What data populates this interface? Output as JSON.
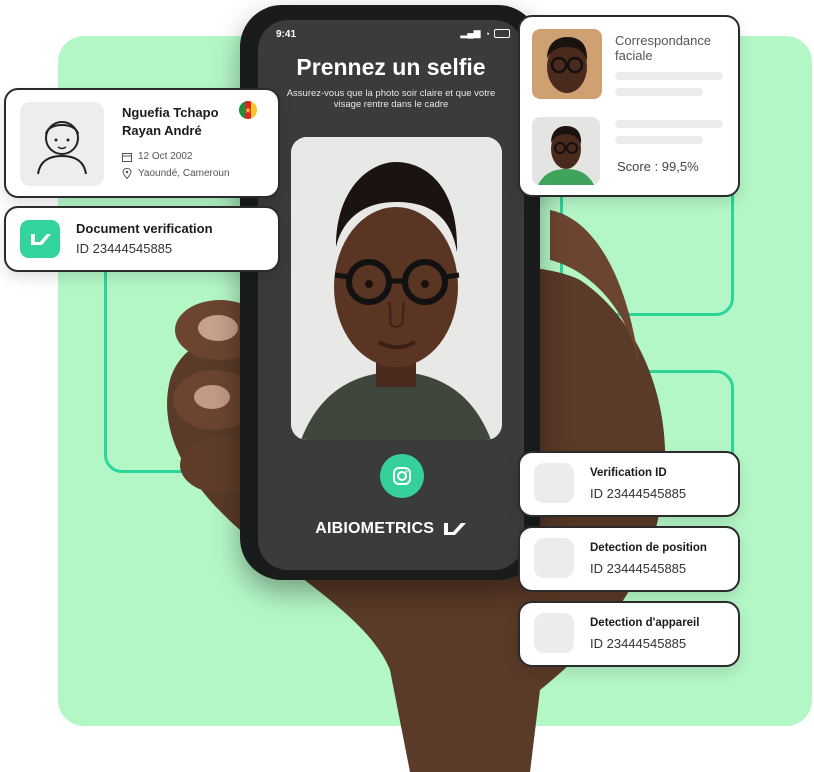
{
  "phone": {
    "status_time": "9:41",
    "title": "Prennez un selfie",
    "subtitle": "Assurez-vous que la photo soir claire et que votre visage rentre dans le cadre",
    "brand": "AIBIOMETRICS"
  },
  "profile_card": {
    "name_line1": "Nguefia Tchapo",
    "name_line2": "Rayan André",
    "date": "12 Oct 2002",
    "location": "Yaoundé, Cameroun"
  },
  "document_card": {
    "title": "Document verification",
    "id": "ID 23444545885"
  },
  "match_card": {
    "title": "Correspondance faciale",
    "score": "Score : 99,5%"
  },
  "checks": [
    {
      "title": "Verification ID",
      "id": "ID 23444545885"
    },
    {
      "title": "Detection de position",
      "id": "ID 23444545885"
    },
    {
      "title": "Detection d'appareil",
      "id": "ID 23444545885"
    }
  ],
  "colors": {
    "panel": "#b4f7c7",
    "accent": "#2cd59a",
    "shutter": "#36d09b"
  }
}
